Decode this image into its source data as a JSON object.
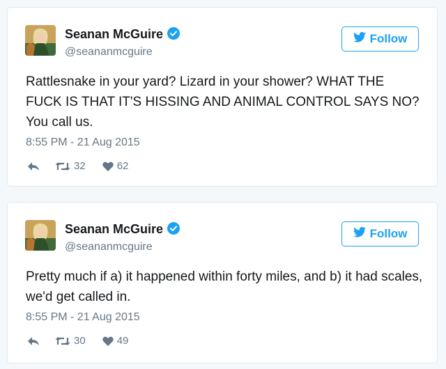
{
  "accent_color": "#1da1f2",
  "tweets": [
    {
      "author": "Seanan McGuire",
      "handle": "@seananmcguire",
      "follow_label": "Follow",
      "text": "Rattlesnake in your yard? Lizard in your shower? WHAT THE FUCK IS THAT IT'S HISSING AND ANIMAL CONTROL SAYS NO? You call us.",
      "timestamp": "8:55 PM - 21 Aug 2015",
      "retweets": "32",
      "likes": "62",
      "icons": [
        "avatar",
        "verified-badge-icon",
        "twitter-bird-icon",
        "reply-icon",
        "retweet-icon",
        "heart-icon"
      ]
    },
    {
      "author": "Seanan McGuire",
      "handle": "@seananmcguire",
      "follow_label": "Follow",
      "text": "Pretty much if a) it happened within forty miles, and b) it had scales, we'd get called in.",
      "timestamp": "8:55 PM - 21 Aug 2015",
      "retweets": "30",
      "likes": "49",
      "icons": [
        "avatar",
        "verified-badge-icon",
        "twitter-bird-icon",
        "reply-icon",
        "retweet-icon",
        "heart-icon"
      ]
    }
  ]
}
